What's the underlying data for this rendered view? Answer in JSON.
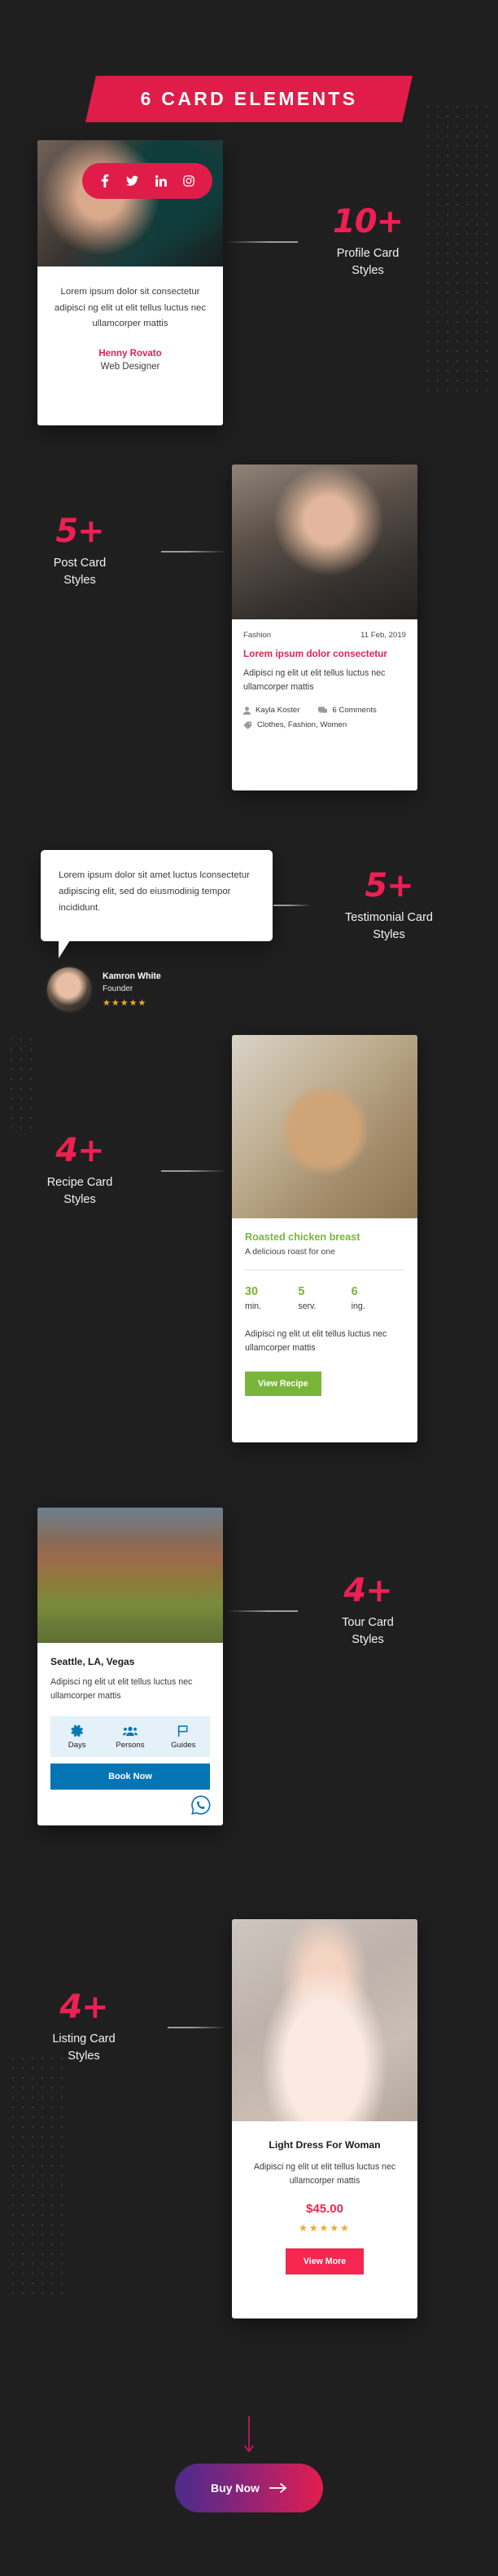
{
  "header": {
    "title": "6 CARD ELEMENTS",
    "accent": "#e01c48"
  },
  "callouts": {
    "profile": {
      "num": "10+",
      "caption": "Profile Card\nStyles"
    },
    "post": {
      "num": "5+",
      "caption": "Post Card\nStyles"
    },
    "testimonial": {
      "num": "5+",
      "caption": "Testimonial Card\nStyles"
    },
    "recipe": {
      "num": "4+",
      "caption": "Recipe Card\nStyles"
    },
    "tour": {
      "num": "4+",
      "caption": "Tour Card\nStyles"
    },
    "listing": {
      "num": "4+",
      "caption": "Listing Card\nStyles"
    }
  },
  "profile_card": {
    "social": [
      "facebook-icon",
      "twitter-icon",
      "linkedin-icon",
      "instagram-icon"
    ],
    "description": "Lorem ipsum dolor sit consectetur adipisci ng elit ut elit tellus luctus nec ullamcorper mattis",
    "name": "Henny Rovato",
    "role": "Web Designer",
    "name_color": "#ec2053"
  },
  "post_card": {
    "category": "Fashion",
    "date": "11 Feb, 2019",
    "title": "Lorem ipsum dolor consectetur",
    "description": "Adipisci ng elit ut elit tellus luctus nec ullamcorper mattis",
    "author": "Kayla Koster",
    "comments": "6 Comments",
    "tags": "Clothes, Fashion, Women",
    "title_color": "#ec2053"
  },
  "testimonial_card": {
    "quote": "Lorem ipsum dolor sit amet luctus lconsectetur adipiscing elit, sed do eiusmodinig tempor incididunt.",
    "name": "Kamron White",
    "role": "Founder",
    "stars": "★★★★★",
    "star_color": "#f0a92b"
  },
  "recipe_card": {
    "title": "Roasted chicken breast",
    "subtitle": "A delicious roast for one",
    "stats": [
      {
        "value": "30",
        "label": "min."
      },
      {
        "value": "5",
        "label": "serv."
      },
      {
        "value": "6",
        "label": "ing."
      }
    ],
    "description": "Adipisci ng elit ut elit tellus luctus nec ullamcorper mattis",
    "button": "View Recipe",
    "accent": "#79b539"
  },
  "tour_card": {
    "title": "Seattle, LA, Vegas",
    "description": "Adipisci ng elit ut elit tellus luctus nec ullamcorper mattis",
    "features": [
      {
        "icon": "gear-icon",
        "label": "Days"
      },
      {
        "icon": "people-icon",
        "label": "Persons"
      },
      {
        "icon": "flag-icon",
        "label": "Guides"
      }
    ],
    "button": "Book Now",
    "whatsapp_icon": "whatsapp-icon",
    "accent": "#0374b4"
  },
  "listing_card": {
    "title": "Light Dress For Woman",
    "description": "Adipisci ng elit ut elit tellus luctus nec ullamcorper mattis",
    "price": "$45.00",
    "stars": "★★★★★",
    "button": "View More",
    "accent": "#f5264f"
  },
  "footer": {
    "arrow_icon": "arrow-down-icon",
    "buy_label": "Buy Now",
    "buy_arrow_icon": "arrow-right-icon"
  }
}
